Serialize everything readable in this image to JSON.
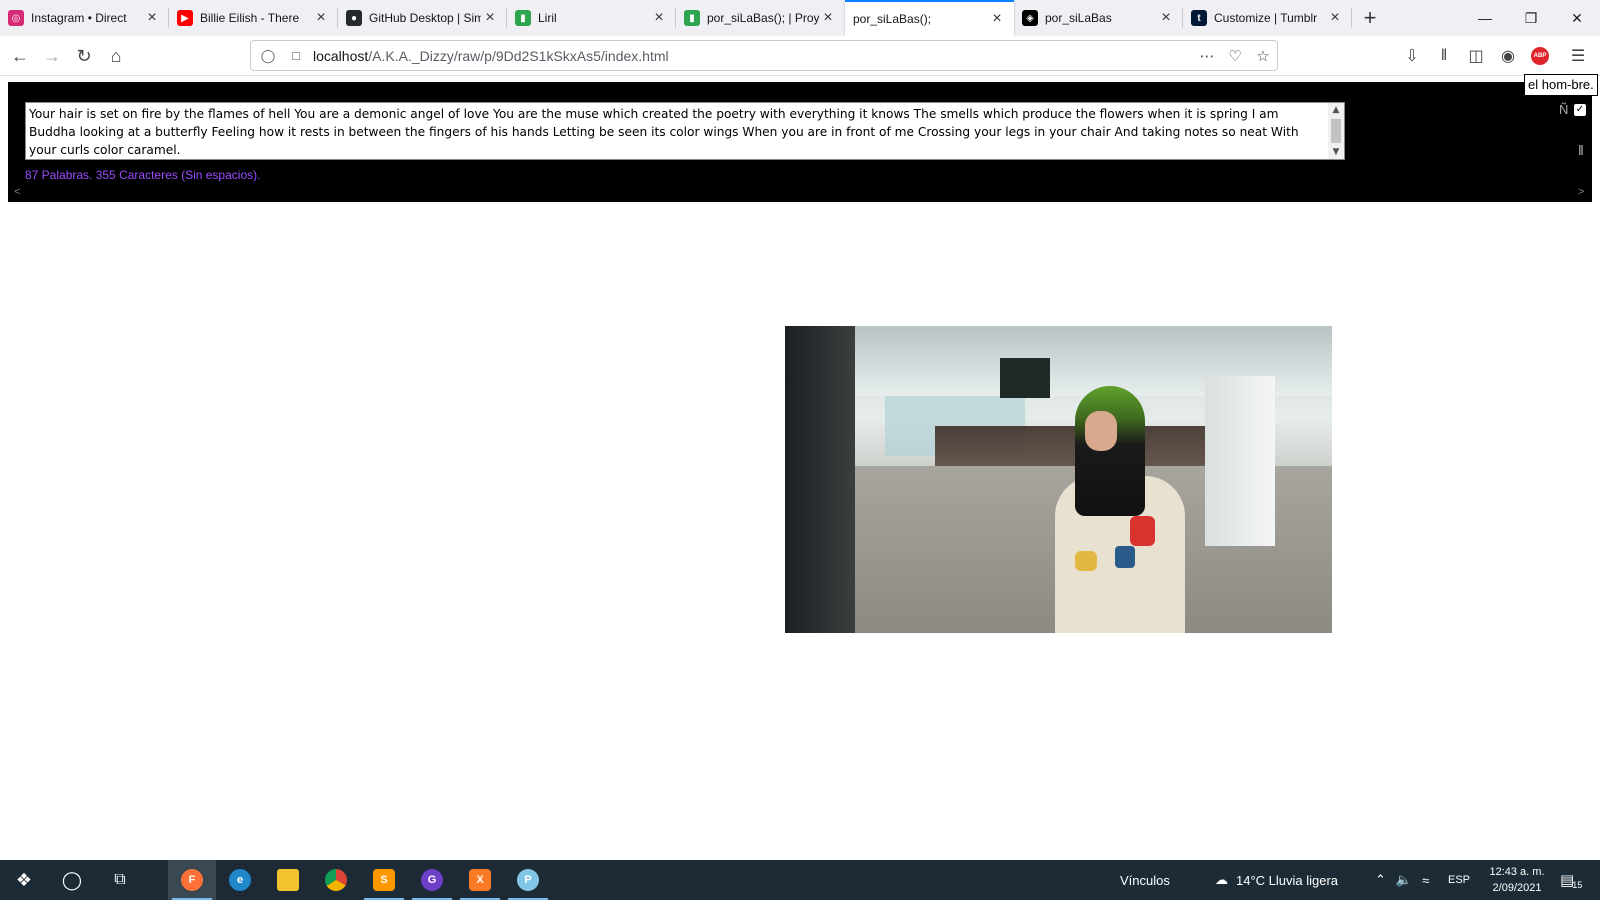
{
  "tabs": [
    {
      "title": "Instagram • Direct",
      "favicon": "instagram-icon",
      "color": "#d62976",
      "glyph": "◎"
    },
    {
      "title": "Billie Eilish - There",
      "favicon": "youtube-icon",
      "color": "#ff0000",
      "glyph": "▶"
    },
    {
      "title": "GitHub Desktop | Sim",
      "favicon": "github-icon",
      "color": "#24292e",
      "glyph": "●"
    },
    {
      "title": "Liril",
      "favicon": "bars-icon",
      "color": "#2ea44f",
      "glyph": "▮"
    },
    {
      "title": "por_siLaBas(); | Proye",
      "favicon": "bars-icon",
      "color": "#2ea44f",
      "glyph": "▮"
    },
    {
      "title": "por_siLaBas();",
      "favicon": "",
      "color": "",
      "glyph": ""
    },
    {
      "title": "por_siLaBas",
      "favicon": "codepen-icon",
      "color": "#000000",
      "glyph": "◈"
    },
    {
      "title": "Customize | Tumblr",
      "favicon": "tumblr-icon",
      "color": "#001935",
      "glyph": "t"
    }
  ],
  "active_tab_index": 5,
  "navbar": {
    "url_host": "localhost",
    "url_path": "/A.K.A._Dizzy/raw/p/9Dd2S1kSkxAs5/index.html"
  },
  "page": {
    "poem": "Your hair is set on fire by the flames of hell You are a demonic angel of love You are the muse which created the poetry with everything it knows The smells which produce the flowers when it is spring I am Buddha looking at a butterfly Feeling how it rests in between the fingers of his hands Letting be seen its color wings When you are in front of me Crossing your legs in your chair And taking notes so neat With your curls color caramel.",
    "word_count": "87 Palabras. 355 Caracteres (Sin espacios).",
    "ntilde_label": "Ñ",
    "tooltip": "el hom-bre."
  },
  "taskbar": {
    "vinculos": "Vínculos",
    "weather": "14°C  Lluvia ligera",
    "language": "ESP",
    "time": "12:43 a. m.",
    "date": "2/09/2021",
    "notifications": "15"
  },
  "colors": {
    "accent": "#0a84ff",
    "word_count": "#9b4dff",
    "taskbar": "#1c2b36"
  }
}
